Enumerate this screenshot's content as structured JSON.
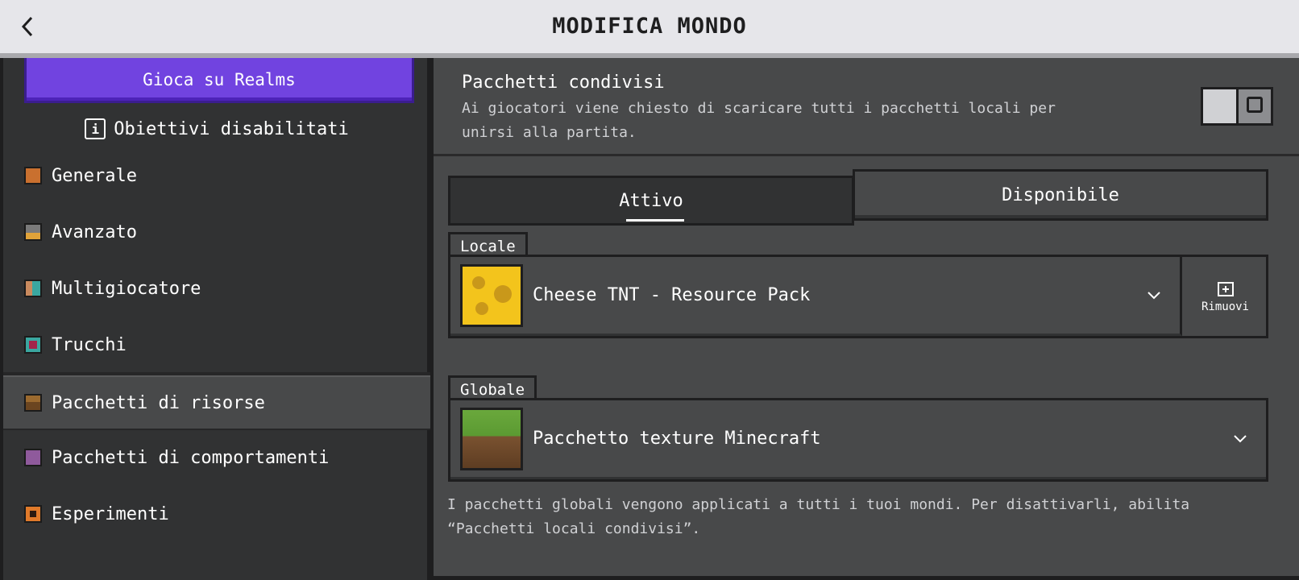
{
  "header": {
    "title": "MODIFICA MONDO",
    "back_icon": "chevron-left-icon"
  },
  "sidebar": {
    "realms_button": "Gioca su Realms",
    "achievements": {
      "icon": "info-icon",
      "label": "Obiettivi disabilitati"
    },
    "items": [
      {
        "label": "Generale",
        "icon": "gear-icon",
        "color": "#c9702f"
      },
      {
        "label": "Avanzato",
        "icon": "furnace-icon",
        "color": "#e0a33a"
      },
      {
        "label": "Multigiocatore",
        "icon": "players-icon",
        "color": "#c98a5e"
      },
      {
        "label": "Trucchi",
        "icon": "cheats-icon",
        "color": "#a3244a"
      },
      {
        "label": "Pacchetti di risorse",
        "icon": "chest-icon",
        "color": "#9b6a2f"
      },
      {
        "label": "Pacchetti di comportamenti",
        "icon": "behavior-icon",
        "color": "#8f5a9c"
      },
      {
        "label": "Esperimenti",
        "icon": "experiment-icon",
        "color": "#e07a2a"
      }
    ],
    "active_index": 4
  },
  "main": {
    "shared_packs": {
      "title": "Pacchetti condivisi",
      "description": "Ai giocatori viene chiesto di scaricare tutti i pacchetti locali per unirsi alla partita.",
      "toggle_on": false
    },
    "tabs": [
      {
        "label": "Attivo",
        "active": true
      },
      {
        "label": "Disponibile",
        "active": false
      }
    ],
    "local": {
      "label": "Locale",
      "pack_name": "Cheese TNT - Resource Pack",
      "remove_label": "Rimuovi"
    },
    "global": {
      "label": "Globale",
      "pack_name": "Pacchetto texture Minecraft"
    },
    "footer_note": "I pacchetti globali vengono applicati a tutti i tuoi mondi. Per disattivarli, abilita “Pacchetti locali condivisi”."
  },
  "colors": {
    "accent": "#7143e0",
    "panel": "#48494a",
    "sidebar": "#313233"
  }
}
